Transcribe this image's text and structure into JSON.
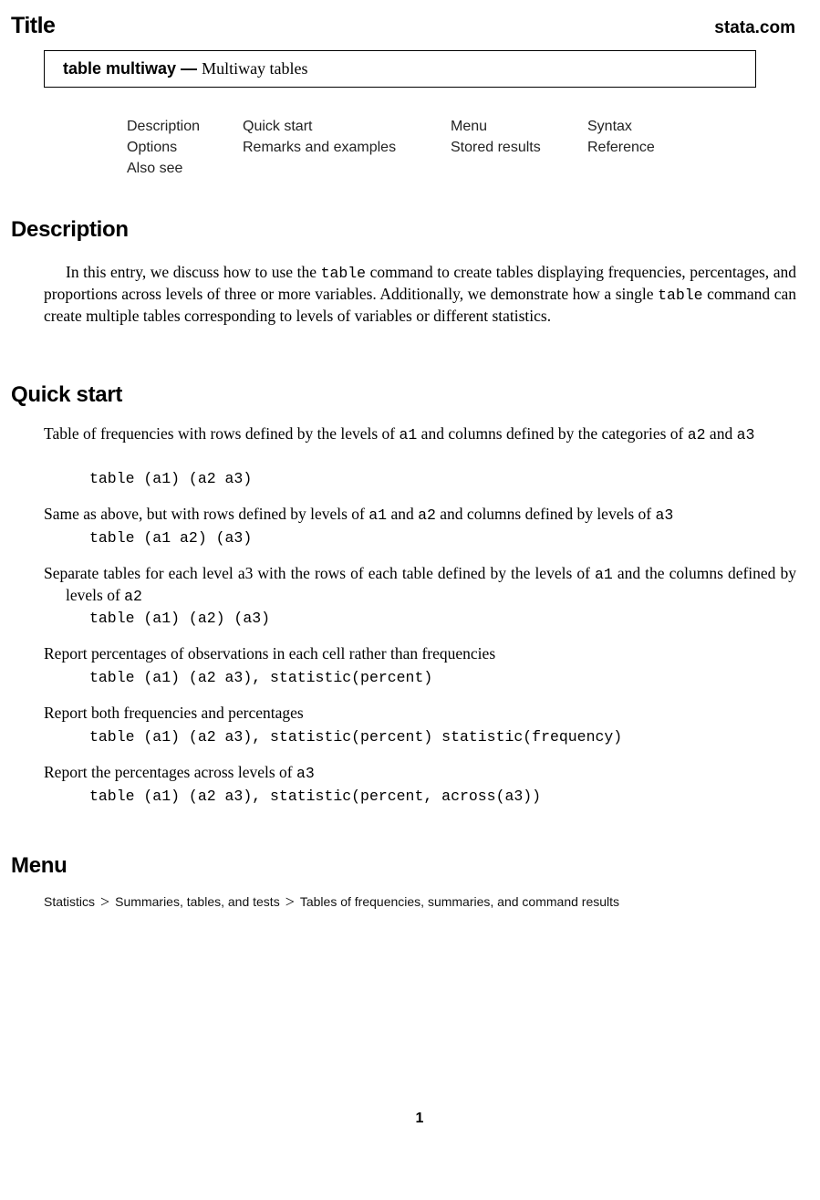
{
  "header": {
    "title": "Title",
    "site": "stata.com"
  },
  "title_box": {
    "command": "table multiway",
    "dash": "—",
    "description": "Multiway tables"
  },
  "toc": [
    {
      "label": "Description"
    },
    {
      "label": "Quick start"
    },
    {
      "label": "Menu"
    },
    {
      "label": "Syntax"
    },
    {
      "label": "Options"
    },
    {
      "label": "Remarks and examples"
    },
    {
      "label": "Stored results"
    },
    {
      "label": "Reference"
    },
    {
      "label": "Also see"
    }
  ],
  "description": {
    "heading": "Description",
    "parts": [
      "In this entry, we discuss how to use the ",
      "table",
      " command to create tables displaying frequencies, percentages, and proportions across levels of three or more variables. Additionally, we demonstrate how a single ",
      "table",
      " command can create multiple tables corresponding to levels of variables or different statistics."
    ]
  },
  "quick_start": {
    "heading": "Quick start",
    "items": [
      {
        "desc": [
          "Table of frequencies with rows defined by the levels of ",
          "a1",
          " and columns defined by the categories of ",
          "a2",
          " and ",
          "a3"
        ],
        "command": "table (a1) (a2 a3)"
      },
      {
        "desc": [
          "Same as above, but with rows defined by levels of ",
          "a1",
          " and ",
          "a2",
          " and columns defined by levels of ",
          "a3"
        ],
        "command": "table (a1 a2) (a3)"
      },
      {
        "desc": [
          "Separate tables for each level a3 with the rows of each table defined by the levels of ",
          "a1",
          " and the columns defined by levels of ",
          "a2"
        ],
        "command": "table (a1) (a2) (a3)"
      },
      {
        "desc": [
          "Report percentages of observations in each cell rather than frequencies"
        ],
        "command": "table (a1) (a2 a3), statistic(percent)"
      },
      {
        "desc": [
          "Report both frequencies and percentages"
        ],
        "command": "table (a1) (a2 a3), statistic(percent) statistic(frequency)"
      },
      {
        "desc": [
          "Report the percentages across levels of ",
          "a3"
        ],
        "command": "table (a1) (a2 a3), statistic(percent, across(a3))"
      }
    ]
  },
  "menu": {
    "heading": "Menu",
    "path": [
      "Statistics",
      "Summaries, tables, and tests",
      "Tables of frequencies, summaries, and command results"
    ],
    "separator": ">"
  },
  "footer": {
    "page_number": "1"
  }
}
